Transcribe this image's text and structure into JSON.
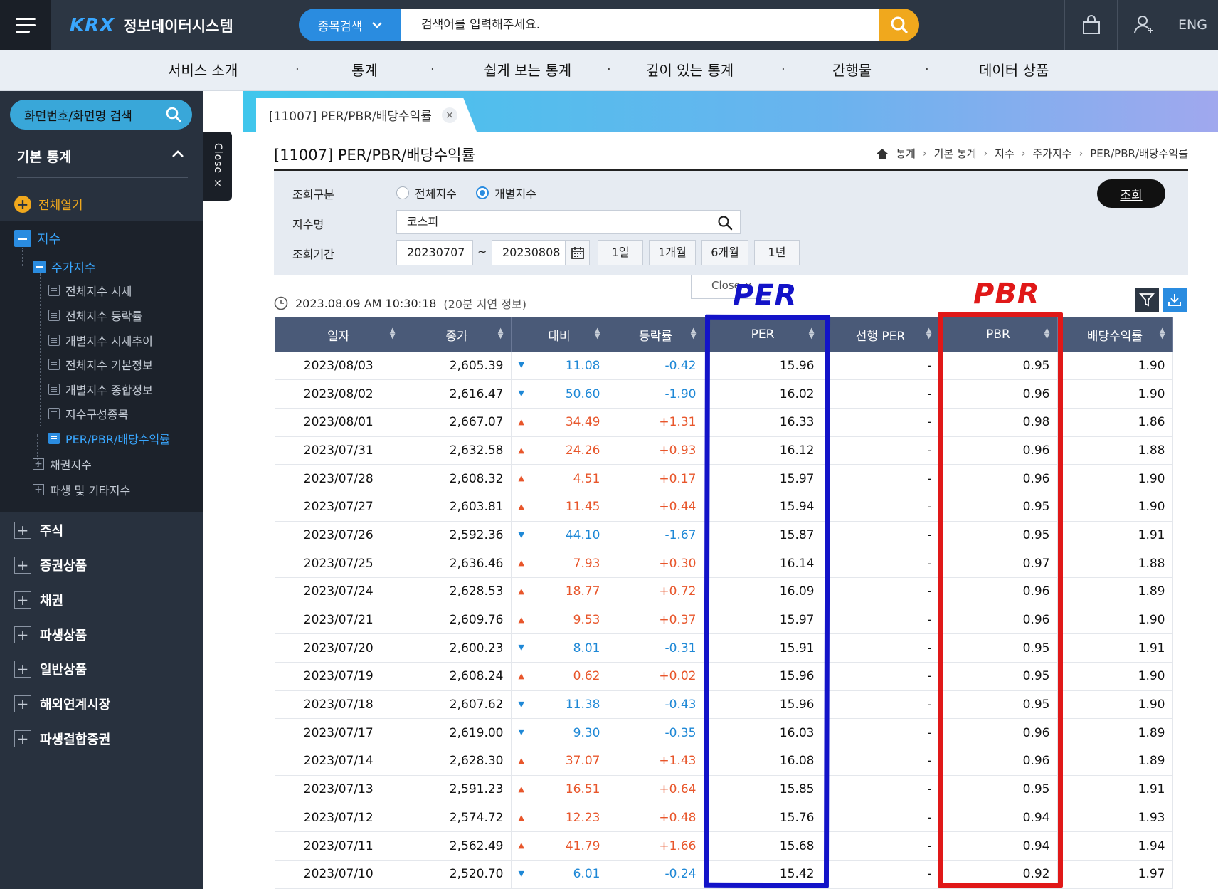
{
  "header": {
    "logo_mark": "KRX",
    "logo_text": "정보데이터시스템",
    "search_type": "종목검색",
    "search_placeholder": "검색어를 입력해주세요.",
    "lang": "ENG"
  },
  "nav": {
    "items": [
      "서비스 소개",
      "통계",
      "쉽게 보는 통계",
      "깊이 있는 통계",
      "간행물",
      "데이터 상품"
    ],
    "separator": "·"
  },
  "sidebar": {
    "search_label": "화면번호/화면명 검색",
    "section_title": "기본 통계",
    "open_all": "전체열기",
    "close_tab": "Close ×",
    "tree": {
      "root": "지수",
      "group": "주가지수",
      "leaves": [
        "전체지수 시세",
        "전체지수 등락률",
        "개별지수 시세추이",
        "전체지수 기본정보",
        "개별지수 종합정보",
        "지수구성종목",
        "PER/PBR/배당수익률"
      ],
      "siblings": [
        "채권지수",
        "파생 및 기타지수"
      ]
    },
    "categories": [
      "주식",
      "증권상품",
      "채권",
      "파생상품",
      "일반상품",
      "해외연계시장",
      "파생결합증권"
    ]
  },
  "tab": {
    "label": "[11007] PER/PBR/배당수익률",
    "close": "×"
  },
  "page": {
    "title": "[11007] PER/PBR/배당수익률",
    "breadcrumb": [
      "통계",
      "기본 통계",
      "지수",
      "주가지수",
      "PER/PBR/배당수익률"
    ]
  },
  "filters": {
    "type_label": "조회구분",
    "radio_all": "전체지수",
    "radio_individual": "개별지수",
    "selected": "개별지수",
    "index_label": "지수명",
    "index_value": "코스피",
    "period_label": "조회기간",
    "start_date": "20230707",
    "tilde": "~",
    "end_date": "20230808",
    "periods": [
      "1일",
      "1개월",
      "6개월",
      "1년"
    ],
    "query_button": "조회",
    "close_popup": "Close ×"
  },
  "timestamp": {
    "time": "2023.08.09 AM 10:30:18",
    "note": "(20분 지연 정보)"
  },
  "table": {
    "columns": [
      "일자",
      "종가",
      "대비",
      "등락률",
      "PER",
      "선행 PER",
      "PBR",
      "배당수익률"
    ],
    "rows": [
      {
        "date": "2023/08/03",
        "close": "2,605.39",
        "dir": "down",
        "change": "11.08",
        "rate": "-0.42",
        "per": "15.96",
        "fper": "-",
        "pbr": "0.95",
        "div": "1.90"
      },
      {
        "date": "2023/08/02",
        "close": "2,616.47",
        "dir": "down",
        "change": "50.60",
        "rate": "-1.90",
        "per": "16.02",
        "fper": "-",
        "pbr": "0.96",
        "div": "1.90"
      },
      {
        "date": "2023/08/01",
        "close": "2,667.07",
        "dir": "up",
        "change": "34.49",
        "rate": "+1.31",
        "per": "16.33",
        "fper": "-",
        "pbr": "0.98",
        "div": "1.86"
      },
      {
        "date": "2023/07/31",
        "close": "2,632.58",
        "dir": "up",
        "change": "24.26",
        "rate": "+0.93",
        "per": "16.12",
        "fper": "-",
        "pbr": "0.96",
        "div": "1.88"
      },
      {
        "date": "2023/07/28",
        "close": "2,608.32",
        "dir": "up",
        "change": "4.51",
        "rate": "+0.17",
        "per": "15.97",
        "fper": "-",
        "pbr": "0.96",
        "div": "1.90"
      },
      {
        "date": "2023/07/27",
        "close": "2,603.81",
        "dir": "up",
        "change": "11.45",
        "rate": "+0.44",
        "per": "15.94",
        "fper": "-",
        "pbr": "0.95",
        "div": "1.90"
      },
      {
        "date": "2023/07/26",
        "close": "2,592.36",
        "dir": "down",
        "change": "44.10",
        "rate": "-1.67",
        "per": "15.87",
        "fper": "-",
        "pbr": "0.95",
        "div": "1.91"
      },
      {
        "date": "2023/07/25",
        "close": "2,636.46",
        "dir": "up",
        "change": "7.93",
        "rate": "+0.30",
        "per": "16.14",
        "fper": "-",
        "pbr": "0.97",
        "div": "1.88"
      },
      {
        "date": "2023/07/24",
        "close": "2,628.53",
        "dir": "up",
        "change": "18.77",
        "rate": "+0.72",
        "per": "16.09",
        "fper": "-",
        "pbr": "0.96",
        "div": "1.89"
      },
      {
        "date": "2023/07/21",
        "close": "2,609.76",
        "dir": "up",
        "change": "9.53",
        "rate": "+0.37",
        "per": "15.97",
        "fper": "-",
        "pbr": "0.96",
        "div": "1.90"
      },
      {
        "date": "2023/07/20",
        "close": "2,600.23",
        "dir": "down",
        "change": "8.01",
        "rate": "-0.31",
        "per": "15.91",
        "fper": "-",
        "pbr": "0.95",
        "div": "1.91"
      },
      {
        "date": "2023/07/19",
        "close": "2,608.24",
        "dir": "up",
        "change": "0.62",
        "rate": "+0.02",
        "per": "15.96",
        "fper": "-",
        "pbr": "0.95",
        "div": "1.90"
      },
      {
        "date": "2023/07/18",
        "close": "2,607.62",
        "dir": "down",
        "change": "11.38",
        "rate": "-0.43",
        "per": "15.96",
        "fper": "-",
        "pbr": "0.95",
        "div": "1.90"
      },
      {
        "date": "2023/07/17",
        "close": "2,619.00",
        "dir": "down",
        "change": "9.30",
        "rate": "-0.35",
        "per": "16.03",
        "fper": "-",
        "pbr": "0.96",
        "div": "1.89"
      },
      {
        "date": "2023/07/14",
        "close": "2,628.30",
        "dir": "up",
        "change": "37.07",
        "rate": "+1.43",
        "per": "16.08",
        "fper": "-",
        "pbr": "0.96",
        "div": "1.89"
      },
      {
        "date": "2023/07/13",
        "close": "2,591.23",
        "dir": "up",
        "change": "16.51",
        "rate": "+0.64",
        "per": "15.85",
        "fper": "-",
        "pbr": "0.95",
        "div": "1.91"
      },
      {
        "date": "2023/07/12",
        "close": "2,574.72",
        "dir": "up",
        "change": "12.23",
        "rate": "+0.48",
        "per": "15.76",
        "fper": "-",
        "pbr": "0.94",
        "div": "1.93"
      },
      {
        "date": "2023/07/11",
        "close": "2,562.49",
        "dir": "up",
        "change": "41.79",
        "rate": "+1.66",
        "per": "15.68",
        "fper": "-",
        "pbr": "0.94",
        "div": "1.94"
      },
      {
        "date": "2023/07/10",
        "close": "2,520.70",
        "dir": "down",
        "change": "6.01",
        "rate": "-0.24",
        "per": "15.42",
        "fper": "-",
        "pbr": "0.92",
        "div": "1.97"
      }
    ]
  },
  "annotations": {
    "per_label": "PER",
    "pbr_label": "PBR",
    "per_color": "#1313c8",
    "pbr_color": "#e01818"
  },
  "colors": {
    "up": "#e8562b",
    "down": "#1e88d6",
    "accent": "#2a8ce0",
    "search_button": "#f0a81d"
  }
}
